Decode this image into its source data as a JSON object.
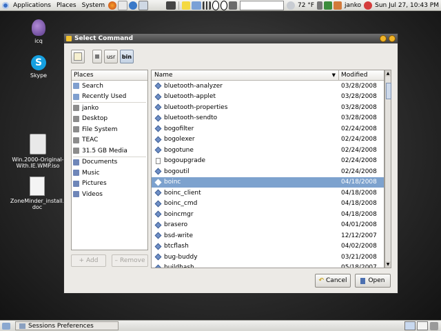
{
  "top_panel": {
    "menus": [
      "Applications",
      "Places",
      "System"
    ],
    "weather": "72 °F",
    "user": "janko",
    "clock": "Sun Jul 27, 10:43 PM"
  },
  "desktop_icons": [
    {
      "label": "icq"
    },
    {
      "label": "Skype"
    },
    {
      "label": "Win.2000-Original-With.IE.WMP.iso"
    },
    {
      "label": "ZoneMinder_install.doc"
    }
  ],
  "dialog": {
    "title": "Select Command",
    "path": [
      "usr",
      "bin"
    ],
    "places_header": "Places",
    "places": [
      {
        "label": "Search",
        "group": 1
      },
      {
        "label": "Recently Used",
        "group": 1
      },
      {
        "label": "janko",
        "group": 2
      },
      {
        "label": "Desktop",
        "group": 2
      },
      {
        "label": "File System",
        "group": 2
      },
      {
        "label": "TEAC",
        "group": 2
      },
      {
        "label": "31.5 GB Media",
        "group": 2
      },
      {
        "label": "Documents",
        "group": 3
      },
      {
        "label": "Music",
        "group": 3
      },
      {
        "label": "Pictures",
        "group": 3
      },
      {
        "label": "Videos",
        "group": 3
      }
    ],
    "add_label": "Add",
    "remove_label": "Remove",
    "columns": {
      "name": "Name",
      "modified": "Modified"
    },
    "files": [
      {
        "name": "bluetooth-analyzer",
        "modified": "03/28/2008",
        "icon": "exec"
      },
      {
        "name": "bluetooth-applet",
        "modified": "03/28/2008",
        "icon": "exec"
      },
      {
        "name": "bluetooth-properties",
        "modified": "03/28/2008",
        "icon": "exec"
      },
      {
        "name": "bluetooth-sendto",
        "modified": "03/28/2008",
        "icon": "exec"
      },
      {
        "name": "bogofilter",
        "modified": "02/24/2008",
        "icon": "exec"
      },
      {
        "name": "bogolexer",
        "modified": "02/24/2008",
        "icon": "exec"
      },
      {
        "name": "bogotune",
        "modified": "02/24/2008",
        "icon": "exec"
      },
      {
        "name": "bogoupgrade",
        "modified": "02/24/2008",
        "icon": "doc"
      },
      {
        "name": "bogoutil",
        "modified": "02/24/2008",
        "icon": "exec"
      },
      {
        "name": "boinc",
        "modified": "04/18/2008",
        "icon": "exec",
        "selected": true
      },
      {
        "name": "boinc_client",
        "modified": "04/18/2008",
        "icon": "exec"
      },
      {
        "name": "boinc_cmd",
        "modified": "04/18/2008",
        "icon": "exec"
      },
      {
        "name": "boincmgr",
        "modified": "04/18/2008",
        "icon": "exec"
      },
      {
        "name": "brasero",
        "modified": "04/01/2008",
        "icon": "exec"
      },
      {
        "name": "bsd-write",
        "modified": "12/12/2007",
        "icon": "exec"
      },
      {
        "name": "btcflash",
        "modified": "04/02/2008",
        "icon": "exec"
      },
      {
        "name": "bug-buddy",
        "modified": "03/21/2008",
        "icon": "exec"
      },
      {
        "name": "buildhash",
        "modified": "05/18/2007",
        "icon": "exec"
      }
    ],
    "cancel_label": "Cancel",
    "open_label": "Open"
  },
  "bottom_panel": {
    "task": "Sessions Preferences"
  }
}
